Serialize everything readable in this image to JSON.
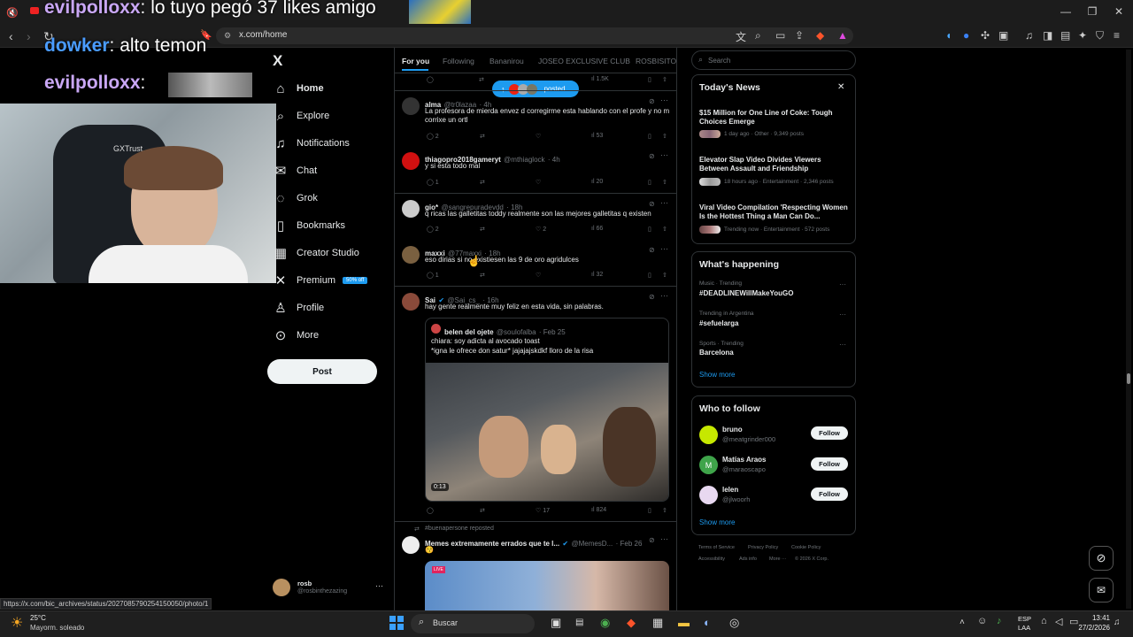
{
  "browser": {
    "url": "x.com/home",
    "status_url": "https://x.com/bic_archives/status/2027085790254150050/photo/1"
  },
  "overlay": {
    "lines": [
      {
        "user": "evilpolloxx",
        "msg": ": lo tuyo pegó 37 likes amigo"
      },
      {
        "user": "dowker",
        "msg": ": alto temon"
      },
      {
        "user": "evilpolloxx",
        "msg": ":"
      }
    ],
    "webcam_brand": "GXTrust."
  },
  "nav": {
    "logo": "X",
    "items": [
      {
        "label": "Home",
        "icon": "home-icon"
      },
      {
        "label": "Explore",
        "icon": "search-icon"
      },
      {
        "label": "Notifications",
        "icon": "bell-icon"
      },
      {
        "label": "Chat",
        "icon": "chat-icon"
      },
      {
        "label": "Grok",
        "icon": "grok-icon"
      },
      {
        "label": "Bookmarks",
        "icon": "bookmark-icon"
      },
      {
        "label": "Creator Studio",
        "icon": "creator-icon"
      },
      {
        "label": "Premium",
        "icon": "premium-icon"
      },
      {
        "label": "Profile",
        "icon": "profile-icon"
      },
      {
        "label": "More",
        "icon": "more-icon"
      }
    ],
    "premium_badge": "50% off",
    "post_label": "Post",
    "account": {
      "name": "rosb",
      "handle": "@rosbinthezazing"
    }
  },
  "timeline": {
    "tabs": [
      "For you",
      "Following",
      "Bananirou",
      "JOSEO EXCLUSIVE CLUB",
      "ROSBISITOS"
    ],
    "posted_pill": "posted",
    "top_stats": {
      "views": "1.5K"
    },
    "tweets": [
      {
        "name": "alma",
        "handle": "@tr0lazaa",
        "time": "· 4h",
        "text": "La profesora de mierda envez d corregirme esta hablando con el profe y no m corrixe un ortl",
        "replies": "2",
        "views": "53"
      },
      {
        "name": "thiagopro2018gameryt",
        "handle": "@mthiaglock",
        "time": "· 4h",
        "text": "y si esta todo mal",
        "replies": "1",
        "views": "20"
      },
      {
        "name": "gio*",
        "handle": "@sangrepuradevdd",
        "time": "· 18h",
        "text": "q ricas las galletitas toddy realmente son las mejores galletitas q existen",
        "replies": "2",
        "likes": "2",
        "views": "66"
      },
      {
        "name": "maxxi",
        "handle": "@77maxxi",
        "time": "· 18h",
        "text": "eso dirias si no existiesen las 9 de oro agridulces",
        "replies": "1",
        "views": "32"
      },
      {
        "name": "Sai",
        "handle": "@Sai_cs_",
        "time": "· 16h",
        "text": "hay gente realmente muy feliz en esta vida, sin palabras.",
        "likes": "17",
        "views": "824"
      }
    ],
    "quote": {
      "name": "belen del ojete",
      "handle": "@soulofalba",
      "time": "· Feb 25",
      "line1": "chiara: soy adicta al avocado toast",
      "line2": "*igna le ofrece don satur* jajajajskdkf lloro de la risa",
      "video_time": "0:13"
    },
    "repost_label": "#buenapersone reposted",
    "last_tweet": {
      "name": "Memes extremamente errados que te l...",
      "handle": "@MemesD...",
      "time": "· Feb 26",
      "text": "😚",
      "live": "LIVE"
    }
  },
  "sidebar": {
    "search_placeholder": "Search",
    "news_title": "Today's News",
    "news": [
      {
        "title": "$15 Million for One Line of Coke: Tough Choices Emerge",
        "meta": "1 day ago · Other · 9,349 posts"
      },
      {
        "title": "Elevator Slap Video Divides Viewers Between Assault and Friendship",
        "meta": "18 hours ago · Entertainment · 2,346 posts"
      },
      {
        "title": "Viral Video Compilation 'Respecting Women Is the Hottest Thing a Man Can Do...",
        "meta": "Trending now · Entertainment · 572 posts"
      }
    ],
    "happening_title": "What's happening",
    "trends": [
      {
        "context": "Music · Trending",
        "name": "#DEADLINEWillMakeYouGO"
      },
      {
        "context": "Trending in Argentina",
        "name": "#sefuelarga"
      },
      {
        "context": "Sports · Trending",
        "name": "Barcelona"
      }
    ],
    "show_more": "Show more",
    "follow_title": "Who to follow",
    "follow": [
      {
        "name": "bruno",
        "handle": "@meatgrinder000",
        "btn": "Follow",
        "color": "#c6e800"
      },
      {
        "name": "Matías Araos",
        "handle": "@maraoscapo",
        "btn": "Follow",
        "color": "#3fa44a"
      },
      {
        "name": "lelen",
        "handle": "@jlwoorh",
        "btn": "Follow",
        "color": "#e8d8f0"
      }
    ],
    "footer": [
      "Terms of Service",
      "Privacy Policy",
      "Cookie Policy",
      "Accessibility",
      "Ads info",
      "More ···",
      "© 2026 X Corp."
    ]
  },
  "taskbar": {
    "weather_temp": "25°C",
    "weather_desc": "Mayorm. soleado",
    "search_label": "Buscar",
    "lang1": "ESP",
    "lang2": "LAA",
    "time": "13:41",
    "date": "27/2/2026"
  }
}
